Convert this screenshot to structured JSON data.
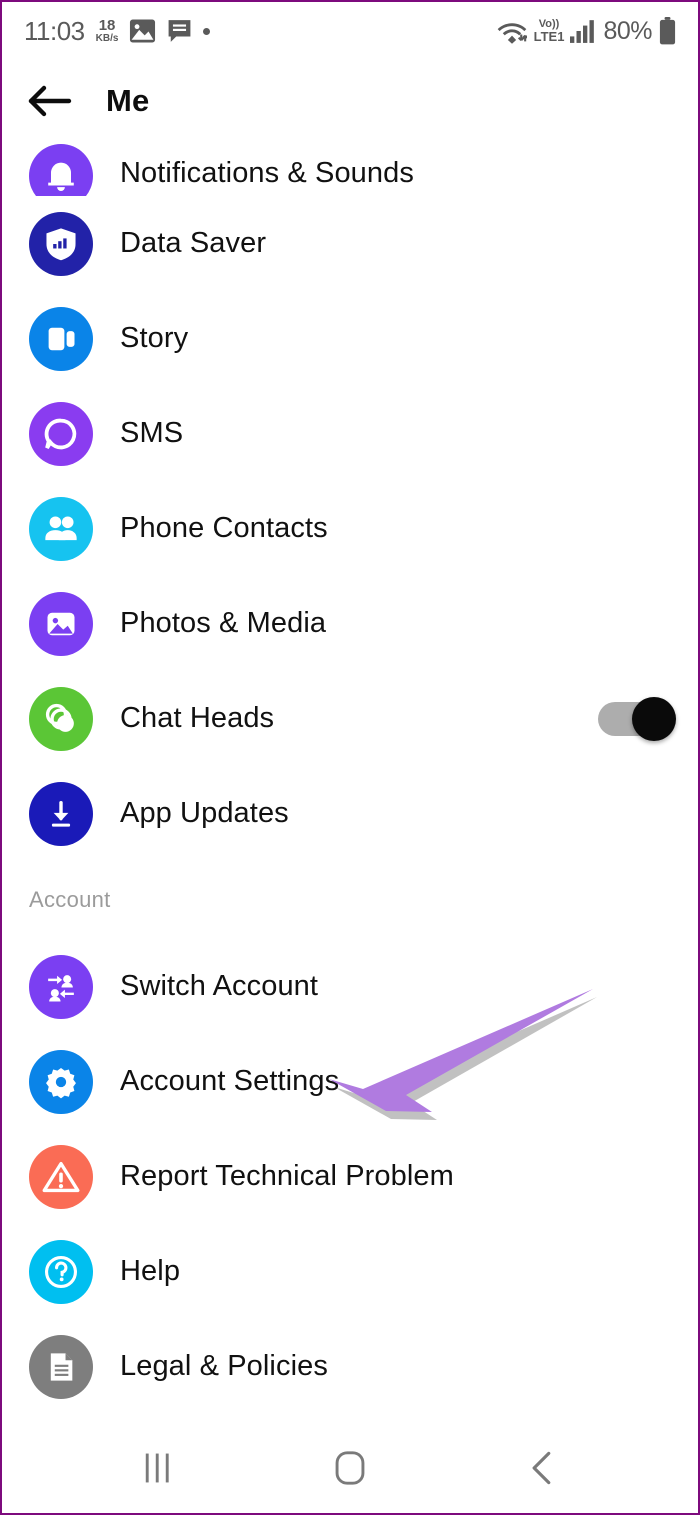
{
  "status_bar": {
    "time": "11:03",
    "network_speed_value": "18",
    "network_speed_unit": "KB/s",
    "icons": [
      "photo-icon",
      "message-icon",
      "dot-indicator"
    ],
    "wifi": "wifi-icon",
    "volte_top": "Vo))",
    "volte_bottom": "LTE1",
    "signal": "signal-bars-icon",
    "battery_percent": "80%",
    "battery": "battery-icon",
    "text_color": "#5a5a5a"
  },
  "app_bar": {
    "back_label": "back-arrow",
    "title": "Me"
  },
  "list": {
    "items": [
      {
        "label": "Notifications & Sounds",
        "icon": "bell-icon",
        "color": "#7B3FF2",
        "clipped": true,
        "toggle": null
      },
      {
        "label": "Data Saver",
        "icon": "shield-bars-icon",
        "color": "#2222A8",
        "clipped": false,
        "toggle": null
      },
      {
        "label": "Story",
        "icon": "story-cards-icon",
        "color": "#0A84E8",
        "clipped": false,
        "toggle": null
      },
      {
        "label": "SMS",
        "icon": "speech-bubble-icon",
        "color": "#8A3CF0",
        "clipped": false,
        "toggle": null
      },
      {
        "label": "Phone Contacts",
        "icon": "people-icon",
        "color": "#16C3F0",
        "clipped": false,
        "toggle": null
      },
      {
        "label": "Photos & Media",
        "icon": "image-icon",
        "color": "#7B3FF2",
        "clipped": false,
        "toggle": null
      },
      {
        "label": "Chat Heads",
        "icon": "chat-bubbles-icon",
        "color": "#5BC636",
        "clipped": false,
        "toggle": "on"
      },
      {
        "label": "App Updates",
        "icon": "download-icon",
        "color": "#1A1AB8",
        "clipped": false,
        "toggle": null
      }
    ]
  },
  "account_section": {
    "header": "Account",
    "items": [
      {
        "label": "Switch Account",
        "icon": "switch-account-icon",
        "color": "#7B3FF2"
      },
      {
        "label": "Account Settings",
        "icon": "gear-icon",
        "color": "#0A84E8"
      },
      {
        "label": "Report Technical Problem",
        "icon": "warning-triangle-icon",
        "color": "#FA6C55"
      },
      {
        "label": "Help",
        "icon": "question-mark-icon",
        "color": "#00BFF0"
      },
      {
        "label": "Legal & Policies",
        "icon": "document-icon",
        "color": "#7E7E7E"
      }
    ]
  },
  "annotation": {
    "arrow": "purple-pointer-arrow",
    "color": "#B07BE0",
    "points_to": "Switch Account"
  },
  "nav_bar": {
    "recents": "recents-icon",
    "home": "home-icon",
    "back": "back-chevron-icon",
    "color": "#7a7a7a"
  }
}
